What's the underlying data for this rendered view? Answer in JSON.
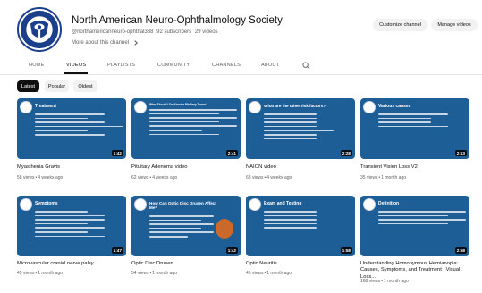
{
  "channel": {
    "name": "North American Neuro-Ophthalmology Society",
    "handle": "@northamericanneuro-ophthal338",
    "subscribers": "92 subscribers",
    "videos_count": "29 videos",
    "about_link": "More about this channel",
    "customize_button": "Customize channel",
    "manage_button": "Manage videos"
  },
  "tabs": [
    "HOME",
    "VIDEOS",
    "PLAYLISTS",
    "COMMUNITY",
    "CHANNELS",
    "ABOUT"
  ],
  "active_tab": "VIDEOS",
  "filters": [
    "Latest",
    "Popular",
    "Oldest"
  ],
  "active_filter": "Latest",
  "videos": [
    {
      "title": "Myasthenia Gravis",
      "views": "58 views",
      "age": "4 weeks ago",
      "duration": "1:42",
      "thumb_heading": "Treatment"
    },
    {
      "title": "Pituitary Adenoma video",
      "views": "62 views",
      "age": "4 weeks ago",
      "duration": "2:41",
      "thumb_heading": "What Should I Do About a Pituitary Tumor?"
    },
    {
      "title": "NAION video",
      "views": "68 views",
      "age": "4 weeks ago",
      "duration": "2:28",
      "thumb_heading": "What are the other risk factors?"
    },
    {
      "title": "Transient Vision Loss V2",
      "views": "35 views",
      "age": "1 month ago",
      "duration": "2:13",
      "thumb_heading": "Various causes"
    },
    {
      "title": "Microvascular cranial nerve palsy",
      "views": "45 views",
      "age": "1 month ago",
      "duration": "1:47",
      "thumb_heading": "Symptoms"
    },
    {
      "title": "Optic Disc Drusen",
      "views": "54 views",
      "age": "1 month ago",
      "duration": "1:42",
      "thumb_heading": "How Can Optic Disc Drusen Affect Me?"
    },
    {
      "title": "Optic Neuritis",
      "views": "45 views",
      "age": "1 month ago",
      "duration": "1:58",
      "thumb_heading": "Exam and Testing"
    },
    {
      "title": "Understanding Homonymous Hemianopia: Causes, Symptoms, and Treatment | Visual Loss...",
      "views": "168 views",
      "age": "1 month ago",
      "duration": "2:58",
      "thumb_heading": "Definition"
    }
  ],
  "colors": {
    "thumb_blue": "#1e5e96",
    "thumb_dark": "#2b3344",
    "accent": "#0f0f0f"
  }
}
